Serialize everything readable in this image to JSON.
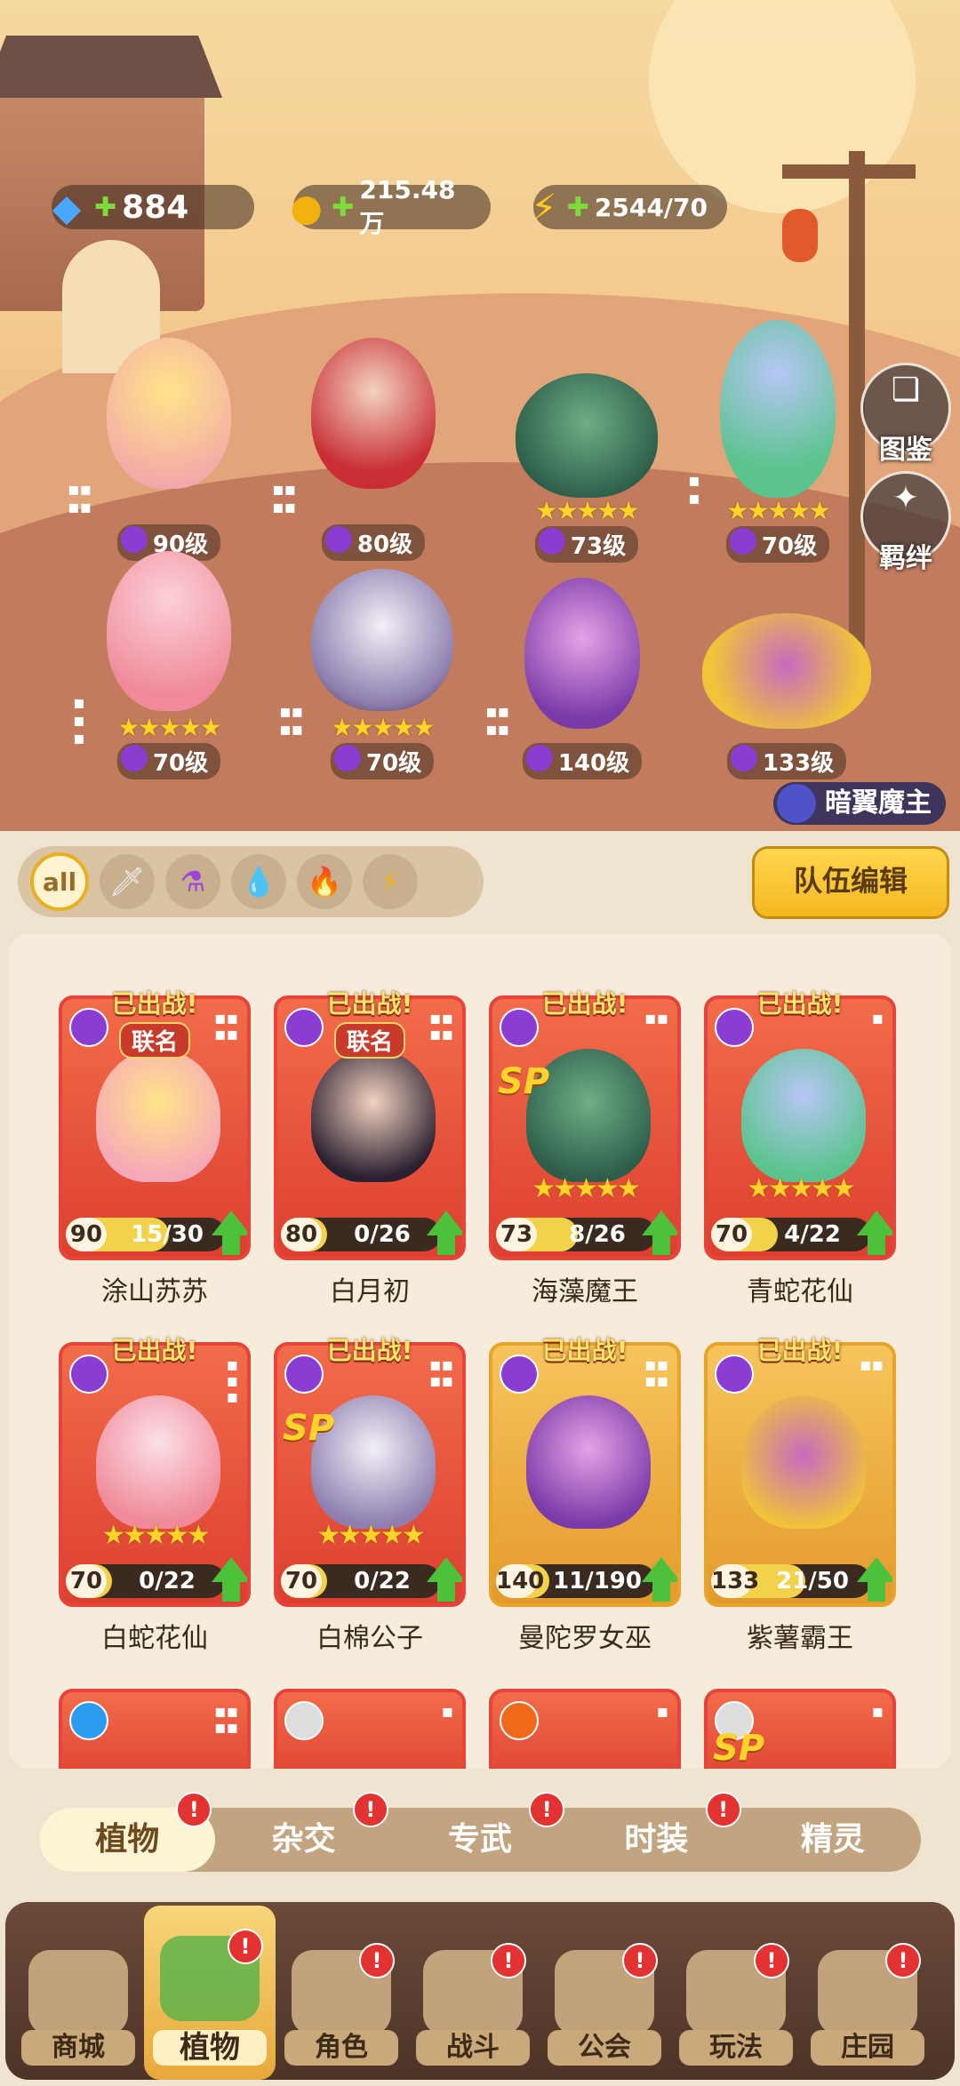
{
  "resources": {
    "gems": "884",
    "coins": "215.48万",
    "energy": "2544/70"
  },
  "side_buttons": {
    "codex": "图鉴",
    "bond": "羁绊"
  },
  "lineup": [
    {
      "level": "90级",
      "stars": ""
    },
    {
      "level": "80级",
      "stars": ""
    },
    {
      "level": "73级",
      "stars": "★★★★★"
    },
    {
      "level": "70级",
      "stars": "★★★★★"
    },
    {
      "level": "70级",
      "stars": "★★★★★"
    },
    {
      "level": "70级",
      "stars": "★★★★★"
    },
    {
      "level": "140级",
      "stars": ""
    },
    {
      "level": "133级",
      "stars": ""
    }
  ],
  "boss_tag": "暗翼魔主",
  "filters": {
    "all_label": "all",
    "icons": [
      "sword-icon",
      "potion-icon",
      "water-drop-icon",
      "fire-icon",
      "lightning-icon"
    ]
  },
  "team_edit": "队伍编辑",
  "cards": [
    {
      "status": "已出战!",
      "tag": "联名",
      "sp": "",
      "stars": "",
      "level": "90",
      "progress": "15/30",
      "fill": 0.5,
      "name": "涂山苏苏"
    },
    {
      "status": "已出战!",
      "tag": "联名",
      "sp": "",
      "stars": "",
      "level": "80",
      "progress": "0/26",
      "fill": 0.0,
      "name": "白月初"
    },
    {
      "status": "已出战!",
      "tag": "",
      "sp": "SP",
      "stars": "★★★★★",
      "level": "73",
      "progress": "8/26",
      "fill": 0.31,
      "name": "海藻魔王"
    },
    {
      "status": "已出战!",
      "tag": "",
      "sp": "",
      "stars": "★★★★★",
      "level": "70",
      "progress": "4/22",
      "fill": 0.18,
      "name": "青蛇花仙"
    },
    {
      "status": "已出战!",
      "tag": "",
      "sp": "",
      "stars": "★★★★★",
      "level": "70",
      "progress": "0/22",
      "fill": 0.0,
      "name": "白蛇花仙"
    },
    {
      "status": "已出战!",
      "tag": "",
      "sp": "SP",
      "stars": "★★★★★",
      "level": "70",
      "progress": "0/22",
      "fill": 0.0,
      "name": "白棉公子"
    },
    {
      "status": "已出战!",
      "tag": "",
      "sp": "",
      "stars": "",
      "level": "140",
      "progress": "11/190",
      "fill": 0.06,
      "name": "曼陀罗女巫"
    },
    {
      "status": "已出战!",
      "tag": "",
      "sp": "",
      "stars": "",
      "level": "133",
      "progress": "21/50",
      "fill": 0.42,
      "name": "紫薯霸王"
    }
  ],
  "partial_cards_sp": [
    "SP"
  ],
  "subtabs": [
    {
      "label": "植物",
      "badge": "!"
    },
    {
      "label": "杂交",
      "badge": "!"
    },
    {
      "label": "专武",
      "badge": "!"
    },
    {
      "label": "时装",
      "badge": "!"
    },
    {
      "label": "精灵",
      "badge": ""
    }
  ],
  "nav": [
    {
      "label": "商城",
      "badge": ""
    },
    {
      "label": "植物",
      "badge": "!"
    },
    {
      "label": "角色",
      "badge": "!"
    },
    {
      "label": "战斗",
      "badge": "!"
    },
    {
      "label": "公会",
      "badge": "!"
    },
    {
      "label": "玩法",
      "badge": "!"
    },
    {
      "label": "庄园",
      "badge": "!"
    }
  ],
  "colors": {
    "card_red": "#e8433a",
    "card_gold": "#e8a32a",
    "upgrade_green": "#4cc23a",
    "badge_red": "#e23232",
    "star_yellow": "#ffd32a"
  }
}
